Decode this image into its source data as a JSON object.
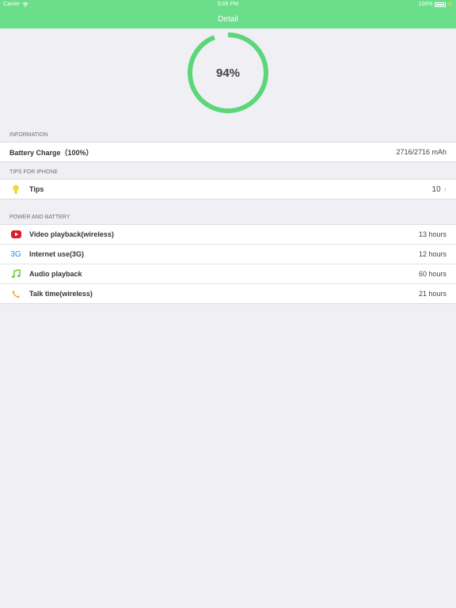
{
  "status": {
    "carrier": "Carrier",
    "time": "5:09 PM",
    "battery": "100%"
  },
  "nav": {
    "title": "Detail"
  },
  "gauge": {
    "percent_text": "94%",
    "level": 0.94,
    "color": "#5cd67a"
  },
  "information": {
    "header": "INFORMATION",
    "row": {
      "label": "Battery Charge（100%）",
      "value": "2716/2716 mAh"
    }
  },
  "tips": {
    "header": "TIPS FOR IPHONE",
    "row": {
      "label": "Tips",
      "value": "10",
      "icon": "lightbulb-icon"
    }
  },
  "power": {
    "header": "POWER AND BATTERY",
    "rows": [
      {
        "label": "Video playback(wireless)",
        "value": "13 hours",
        "icon": "video-play-icon"
      },
      {
        "label": "Internet use(3G)",
        "value": "12 hours",
        "icon": "3g-icon",
        "icon_text": "3G"
      },
      {
        "label": "Audio playback",
        "value": "60 hours",
        "icon": "music-note-icon"
      },
      {
        "label": "Talk time(wireless)",
        "value": "21 hours",
        "icon": "phone-icon"
      }
    ]
  },
  "colors": {
    "accent": "#6ade8a",
    "background": "#efeff4"
  }
}
